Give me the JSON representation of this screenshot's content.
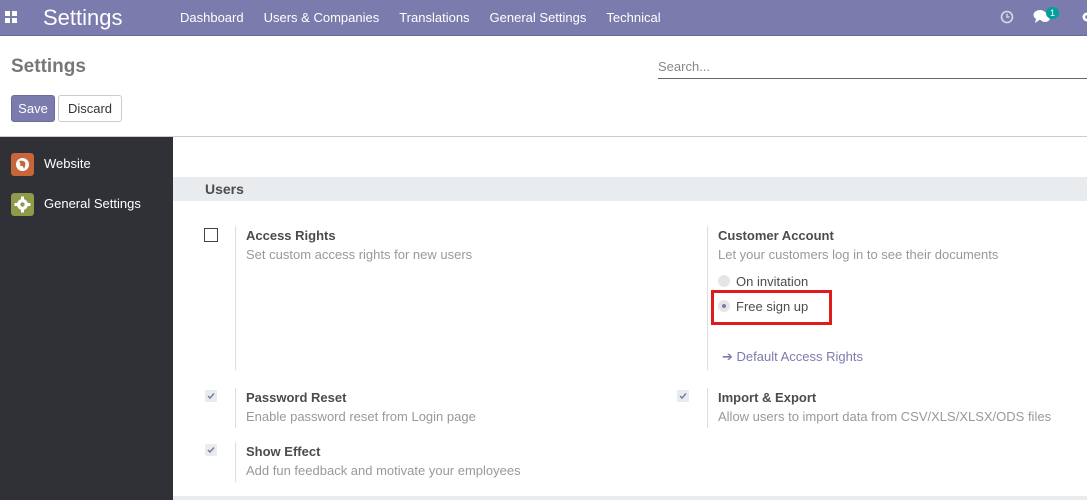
{
  "navbar": {
    "brand": "Settings",
    "menu": [
      "Dashboard",
      "Users & Companies",
      "Translations",
      "General Settings",
      "Technical"
    ],
    "chat_badge": "1",
    "background_color": "#7c7bad"
  },
  "control_panel": {
    "title": "Settings",
    "search_placeholder": "Search...",
    "save_label": "Save",
    "discard_label": "Discard"
  },
  "sidebar": {
    "items": [
      {
        "label": "Website",
        "icon": "globe-icon",
        "icon_color": "#c7653b"
      },
      {
        "label": "General Settings",
        "icon": "gear-icon",
        "icon_color": "#8f9a4b"
      }
    ]
  },
  "section": {
    "title": "Users",
    "settings": [
      {
        "title": "Access Rights",
        "description": "Set custom access rights for new users",
        "checked": false
      },
      {
        "title": "Customer Account",
        "description": "Let your customers log in to see their documents",
        "options": [
          "On invitation",
          "Free sign up"
        ],
        "selected": "Free sign up",
        "link": "Default Access Rights"
      },
      {
        "title": "Password Reset",
        "description": "Enable password reset from Login page",
        "checked": true
      },
      {
        "title": "Import & Export",
        "description": "Allow users to import data from CSV/XLS/XLSX/ODS files",
        "checked": true
      },
      {
        "title": "Show Effect",
        "description": "Add fun feedback and motivate your employees",
        "checked": true
      }
    ]
  },
  "highlight_color": "#e01b1b"
}
